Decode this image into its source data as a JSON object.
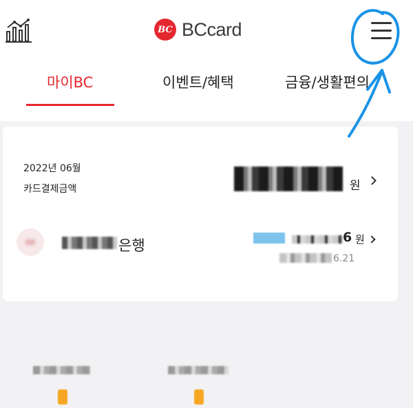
{
  "header": {
    "logo_mark": "BC",
    "logo_text": "BCcard",
    "left_icon": "bar-chart-icon",
    "menu_icon": "hamburger-menu-icon"
  },
  "tabs": [
    {
      "label": "마이BC",
      "active": true
    },
    {
      "label": "이벤트/혜택",
      "active": false
    },
    {
      "label": "금융/생활편의",
      "active": false
    }
  ],
  "summary": {
    "period": "2022년 06월",
    "label": "카드결제금액",
    "amount_unit": "원"
  },
  "payment": {
    "bank_name_suffix": "은행",
    "amount_tail": "6",
    "amount_unit": "원",
    "date_tail": "6.21"
  },
  "colors": {
    "accent": "#e5272f",
    "annotation": "#1a93e6",
    "background": "#f2f2f4"
  }
}
